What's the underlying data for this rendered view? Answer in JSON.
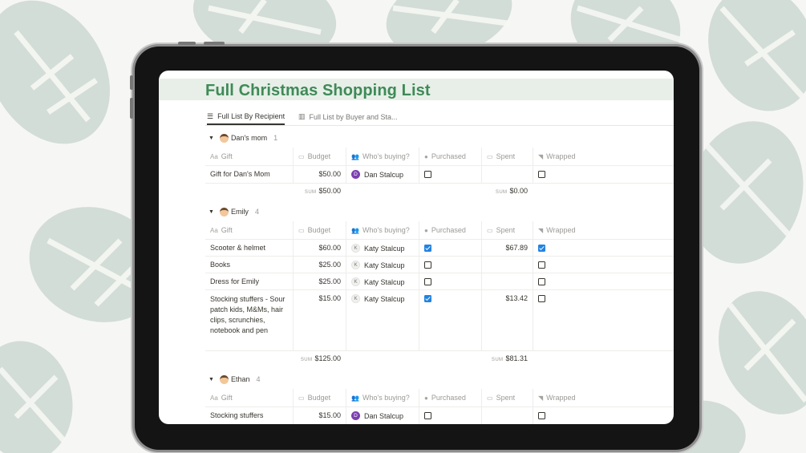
{
  "page": {
    "title": "Full Christmas Shopping List"
  },
  "views": [
    {
      "label": "Full List By Recipient",
      "icon": "list-icon",
      "active": true
    },
    {
      "label": "Full List by Buyer and Sta...",
      "icon": "board-icon",
      "active": false
    }
  ],
  "columns": {
    "gift": "Gift",
    "budget": "Budget",
    "buyer": "Who's buying?",
    "purchased": "Purchased",
    "spent": "Spent",
    "wrapped": "Wrapped"
  },
  "sum_label": "SUM",
  "groups": [
    {
      "name": "Dan's mom",
      "count": "1",
      "rows": [
        {
          "gift": "Gift for Dan's Mom",
          "budget": "$50.00",
          "buyer": "Dan Stalcup",
          "buyer_initial": "D",
          "purchased": false,
          "spent": "",
          "wrapped": false
        }
      ],
      "sum_budget": "$50.00",
      "sum_spent": "$0.00"
    },
    {
      "name": "Emily",
      "count": "4",
      "rows": [
        {
          "gift": "Scooter & helmet",
          "budget": "$60.00",
          "buyer": "Katy Stalcup",
          "buyer_initial": "K",
          "purchased": true,
          "spent": "$67.89",
          "wrapped": true
        },
        {
          "gift": "Books",
          "budget": "$25.00",
          "buyer": "Katy Stalcup",
          "buyer_initial": "K",
          "purchased": false,
          "spent": "",
          "wrapped": false
        },
        {
          "gift": "Dress for Emily",
          "budget": "$25.00",
          "buyer": "Katy Stalcup",
          "buyer_initial": "K",
          "purchased": false,
          "spent": "",
          "wrapped": false
        },
        {
          "gift": "Stocking stuffers - Sour patch kids, M&Ms, hair clips, scrunchies, notebook and pen",
          "budget": "$15.00",
          "buyer": "Katy Stalcup",
          "buyer_initial": "K",
          "purchased": true,
          "spent": "$13.42",
          "wrapped": false
        }
      ],
      "sum_budget": "$125.00",
      "sum_spent": "$81.31"
    },
    {
      "name": "Ethan",
      "count": "4",
      "rows": [
        {
          "gift": "Stocking stuffers",
          "budget": "$15.00",
          "buyer": "Dan Stalcup",
          "buyer_initial": "D",
          "purchased": false,
          "spent": "",
          "wrapped": false
        }
      ]
    }
  ],
  "colors": {
    "title": "#3f8a57",
    "title_band": "#e7efe8",
    "checkbox_checked": "#2383e2",
    "avatar_dan": "#7b3fb0",
    "leaf": "#cdd8d1"
  }
}
